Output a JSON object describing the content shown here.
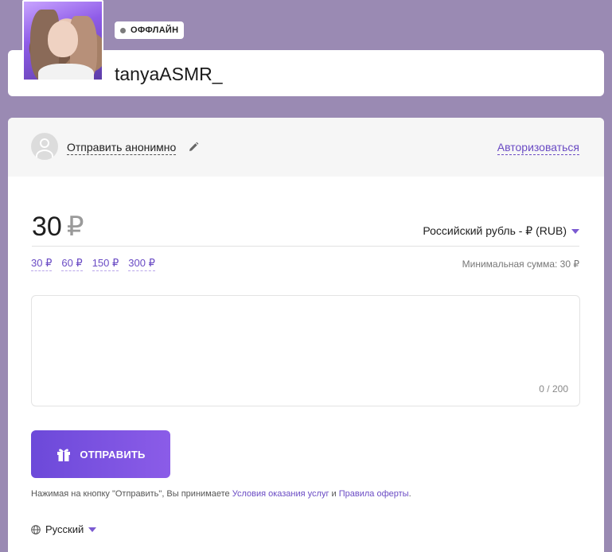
{
  "profile": {
    "status": "ОФФЛАЙН",
    "username": "tanyaASMR_"
  },
  "sender": {
    "anonymous_label": "Отправить анонимно",
    "auth_link": "Авторизоваться"
  },
  "donation": {
    "amount": "30",
    "currency_symbol": "₽",
    "currency_select": "Российский рубль - ₽ (RUB)",
    "presets": [
      "30 ₽",
      "60 ₽",
      "150 ₽",
      "300 ₽"
    ],
    "min_sum": "Минимальная сумма: 30 ₽",
    "message_placeholder": "",
    "message_counter": "0 / 200",
    "send_label": "ОТПРАВИТЬ"
  },
  "terms": {
    "prefix": "Нажимая на кнопку \"Отправить\", Вы принимаете ",
    "link1": "Условия оказания услуг",
    "middle": " и ",
    "link2": "Правила оферты",
    "suffix": "."
  },
  "language": {
    "selected": "Русский"
  },
  "colors": {
    "background": "#9a8ab3",
    "accent": "#6a4bc4",
    "button_start": "#6c49d9",
    "button_end": "#8b5ce8"
  }
}
